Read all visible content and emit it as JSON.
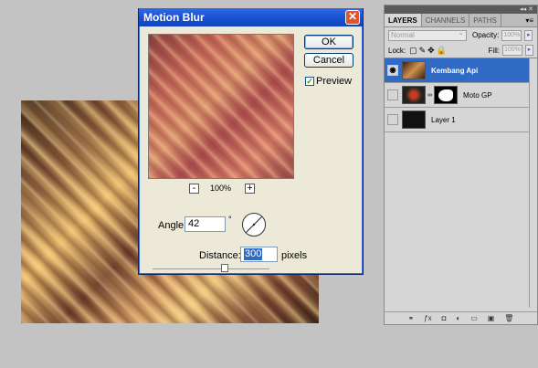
{
  "dialog": {
    "title": "Motion Blur",
    "ok_label": "OK",
    "cancel_label": "Cancel",
    "preview_label": "Preview",
    "preview_checked": true,
    "zoom_minus": "-",
    "zoom_value": "100%",
    "zoom_plus": "+",
    "angle_label": "Angle:",
    "angle_value": "42",
    "angle_unit": "°",
    "distance_label": "Distance:",
    "distance_value": "300",
    "distance_unit": "pixels",
    "distance_slider_fraction": 0.6
  },
  "layers_panel": {
    "top_controls": "◂◂ ✕",
    "tabs": [
      "LAYERS",
      "CHANNELS",
      "PATHS"
    ],
    "blend_mode": "Normal",
    "opacity_label": "Opacity:",
    "opacity_value": "100%",
    "lock_label": "Lock:",
    "fill_label": "Fill:",
    "fill_value": "100%",
    "layers": [
      {
        "name": "Kembang Api",
        "selected": true,
        "visible": true
      },
      {
        "name": "Moto GP",
        "selected": false,
        "visible": false
      },
      {
        "name": "Layer 1",
        "selected": false,
        "visible": false
      }
    ],
    "footer_icons": [
      "link-icon",
      "fx-icon",
      "mask-icon",
      "adjustment-icon",
      "group-icon",
      "new-layer-icon",
      "trash-icon"
    ]
  },
  "colors": {
    "titlebar": "#1b55d2",
    "selection": "#316ac5",
    "close_button": "#e0542e"
  }
}
